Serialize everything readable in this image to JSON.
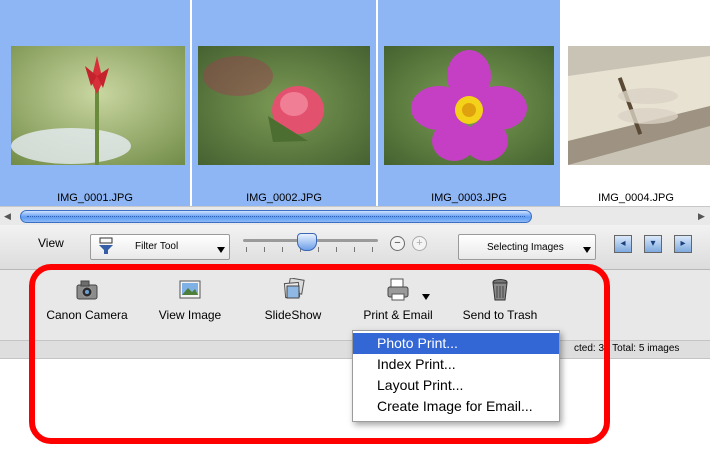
{
  "thumbnails": [
    {
      "filename": "IMG_0001.JPG",
      "selected": true
    },
    {
      "filename": "IMG_0002.JPG",
      "selected": true
    },
    {
      "filename": "IMG_0003.JPG",
      "selected": true
    },
    {
      "filename": "IMG_0004.JPG",
      "selected": false
    }
  ],
  "toolbar": {
    "view_label": "View",
    "filter_tool": "Filter Tool",
    "selecting_images": "Selecting Images"
  },
  "actions": [
    {
      "label": "Canon Camera",
      "icon": "camera-icon"
    },
    {
      "label": "View Image",
      "icon": "picture-icon"
    },
    {
      "label": "SlideShow",
      "icon": "slideshow-icon"
    },
    {
      "label": "Print & Email",
      "icon": "printer-icon"
    },
    {
      "label": "Send to Trash",
      "icon": "trash-icon"
    }
  ],
  "status": {
    "text": "cted: 3 / Total: 5 images"
  },
  "menu": {
    "items": [
      "Photo Print...",
      "Index Print...",
      "Layout Print...",
      "Create Image for Email..."
    ],
    "highlighted": "Photo Print..."
  },
  "colors": {
    "selection": "#8fb6f4",
    "highlight_box": "#ff0000",
    "menu_highlight": "#3367d6"
  }
}
